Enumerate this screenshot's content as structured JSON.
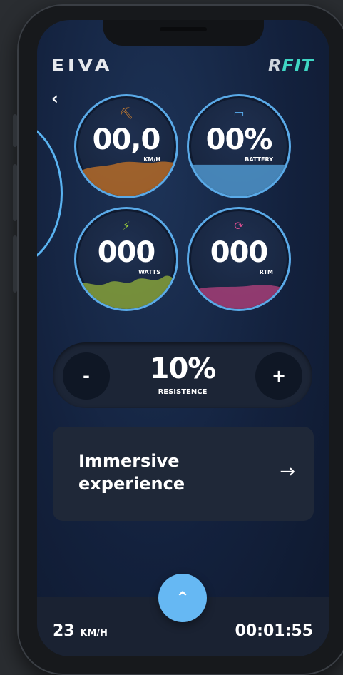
{
  "header": {
    "brand_left": "EIVA",
    "brand_right_prefix": "R",
    "brand_right_accent": "FIT",
    "back_icon": "chevron-left-icon"
  },
  "gauges": [
    {
      "value": "00,0",
      "unit": "KM/H",
      "icon": "pickaxe-icon",
      "icon_color": "#e58a2a",
      "fill_color": "#b56b28"
    },
    {
      "value": "00%",
      "unit": "BATTERY",
      "icon": "battery-icon",
      "icon_color": "#59aef0",
      "fill_color": "#4b8fc4"
    },
    {
      "value": "000",
      "unit": "WATTS",
      "icon": "bolt-icon",
      "icon_color": "#9ed43a",
      "fill_color": "#7f9a3b"
    },
    {
      "value": "000",
      "unit": "RTM",
      "icon": "refresh-icon",
      "icon_color": "#d64e8f",
      "fill_color": "#9d3d74"
    }
  ],
  "resistance": {
    "minus_label": "-",
    "plus_label": "+",
    "value": "10%",
    "label": "RESISTENCE"
  },
  "immersive": {
    "title": "Immersive experience",
    "arrow": "→"
  },
  "footer": {
    "speed_value": "23",
    "speed_unit": "KM/H",
    "time": "00:01:55",
    "fab_icon": "chevron-up-icon"
  },
  "colors": {
    "accent": "#66b8f3",
    "background": "#13213d"
  }
}
